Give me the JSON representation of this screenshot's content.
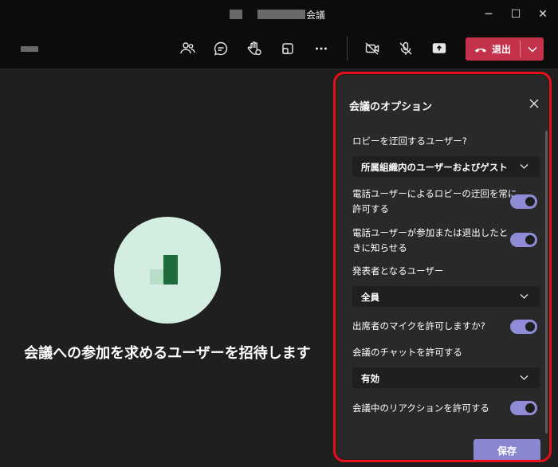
{
  "window": {
    "title_suffix": "会議"
  },
  "toolbar": {
    "leave_label": "退出"
  },
  "stage": {
    "invite_text": "会議への参加を求めるユーザーを招待します"
  },
  "panel": {
    "title": "会議のオプション",
    "bypass_lobby_label": "ロビーを迂回するユーザー?",
    "bypass_lobby_value": "所属組織内のユーザーおよびゲスト",
    "phone_bypass_label_line1": "電話ユーザーによるロビーの迂回を常に",
    "phone_bypass_label_line2": "許可する",
    "phone_bypass_on": true,
    "notify_label_line1": "電話ユーザーが参加または退出したと",
    "notify_label_line2": "きに知らせる",
    "notify_on": true,
    "presenters_label": "発表者となるユーザー",
    "presenters_value": "全員",
    "mic_label": "出席者のマイクを許可しますか?",
    "mic_on": true,
    "chat_label": "会議のチャットを許可する",
    "chat_value": "有効",
    "reactions_label": "会議中のリアクションを許可する",
    "reactions_on": true,
    "save_label": "保存"
  },
  "colors": {
    "leave_button": "#c4314b",
    "toggle_on": "#8f8bd6",
    "save_button": "#8a87d1",
    "highlight_border": "#e8101a",
    "avatar_bg": "#d3ede0"
  }
}
